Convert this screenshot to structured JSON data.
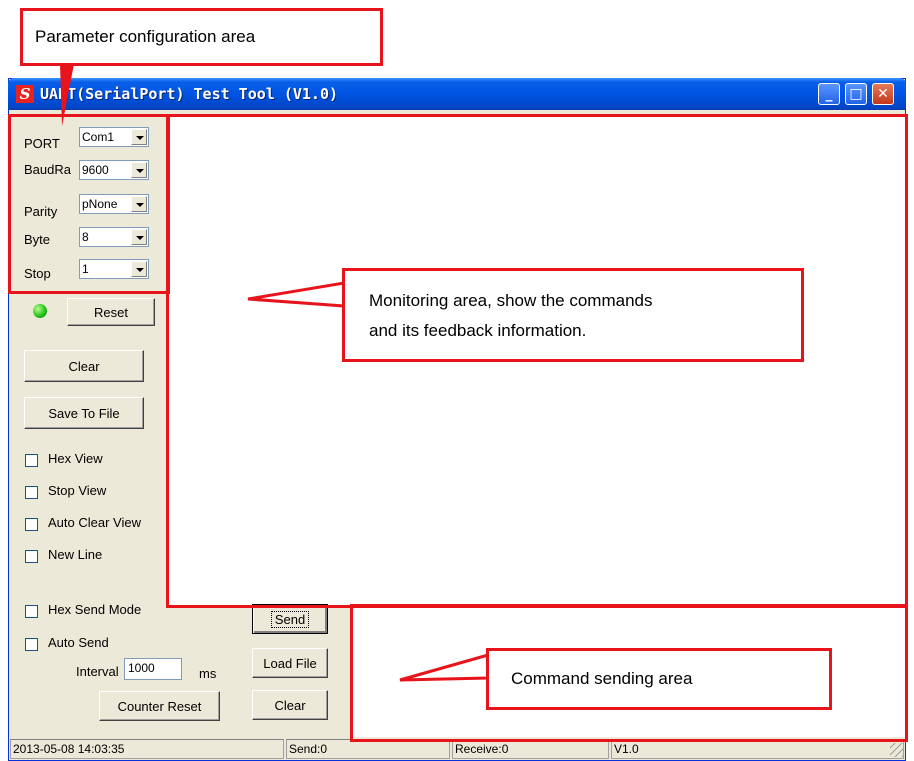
{
  "annotations": {
    "param_area": "Parameter configuration area",
    "monitor_line1": "Monitoring area, show the commands",
    "monitor_line2": "and its feedback information.",
    "send_area": "Command sending area",
    "annotation_color": "#e8141c"
  },
  "window": {
    "icon": "S",
    "title": "UART(SerialPort) Test Tool (V1.0)",
    "controls": {
      "minimize": "_",
      "maximize": "□",
      "close": "✕"
    }
  },
  "config": {
    "port": {
      "label": "PORT",
      "value": "Com1"
    },
    "baud": {
      "label": "BaudRa",
      "value": "9600"
    },
    "parity": {
      "label": "Parity",
      "value": "pNone"
    },
    "byte": {
      "label": "Byte",
      "value": "8"
    },
    "stop": {
      "label": "Stop",
      "value": "1"
    }
  },
  "left": {
    "reset_label": "Reset",
    "clear_label": "Clear",
    "save_label": "Save To File",
    "hex_view": "Hex View",
    "stop_view": "Stop View",
    "auto_clear_view": "Auto Clear View",
    "new_line": "New Line",
    "hex_send_mode": "Hex Send Mode",
    "auto_send": "Auto Send",
    "interval_label": "Interval",
    "interval_value": "1000",
    "interval_unit": "ms",
    "counter_reset": "Counter Reset"
  },
  "send_buttons": {
    "send": "Send",
    "load_file": "Load File",
    "clear": "Clear"
  },
  "status": {
    "datetime": "2013-05-08 14:03:35",
    "send": "Send:0",
    "receive": "Receive:0",
    "version": "V1.0"
  },
  "colors": {
    "title_blue": "#0054e3",
    "window_face": "#ece9d8",
    "led_green": "#26c41e"
  }
}
